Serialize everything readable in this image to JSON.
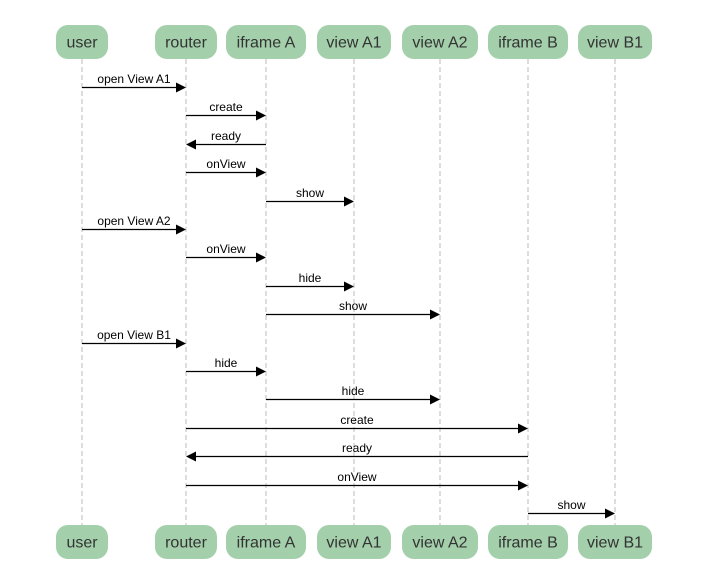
{
  "diagram": {
    "type": "sequence",
    "colors": {
      "participant_fill": "#a3cfab",
      "participant_text": "#333333",
      "lifeline": "#bbbbbb",
      "message": "#000000"
    },
    "participants": [
      {
        "id": "user",
        "label": "user"
      },
      {
        "id": "router",
        "label": "router"
      },
      {
        "id": "iframeA",
        "label": "iframe A"
      },
      {
        "id": "viewA1",
        "label": "view A1"
      },
      {
        "id": "viewA2",
        "label": "view A2"
      },
      {
        "id": "iframeB",
        "label": "iframe B"
      },
      {
        "id": "viewB1",
        "label": "view B1"
      }
    ],
    "messages": [
      {
        "from": "user",
        "to": "router",
        "label": "open View A1"
      },
      {
        "from": "router",
        "to": "iframeA",
        "label": "create"
      },
      {
        "from": "iframeA",
        "to": "router",
        "label": "ready"
      },
      {
        "from": "router",
        "to": "iframeA",
        "label": "onView"
      },
      {
        "from": "iframeA",
        "to": "viewA1",
        "label": "show"
      },
      {
        "from": "user",
        "to": "router",
        "label": "open View A2"
      },
      {
        "from": "router",
        "to": "iframeA",
        "label": "onView"
      },
      {
        "from": "iframeA",
        "to": "viewA1",
        "label": "hide"
      },
      {
        "from": "iframeA",
        "to": "viewA2",
        "label": "show"
      },
      {
        "from": "user",
        "to": "router",
        "label": "open View B1"
      },
      {
        "from": "router",
        "to": "iframeA",
        "label": "hide"
      },
      {
        "from": "iframeA",
        "to": "viewA2",
        "label": "hide"
      },
      {
        "from": "router",
        "to": "iframeB",
        "label": "create"
      },
      {
        "from": "iframeB",
        "to": "router",
        "label": "ready"
      },
      {
        "from": "router",
        "to": "iframeB",
        "label": "onView"
      },
      {
        "from": "iframeB",
        "to": "viewB1",
        "label": "show"
      }
    ]
  }
}
